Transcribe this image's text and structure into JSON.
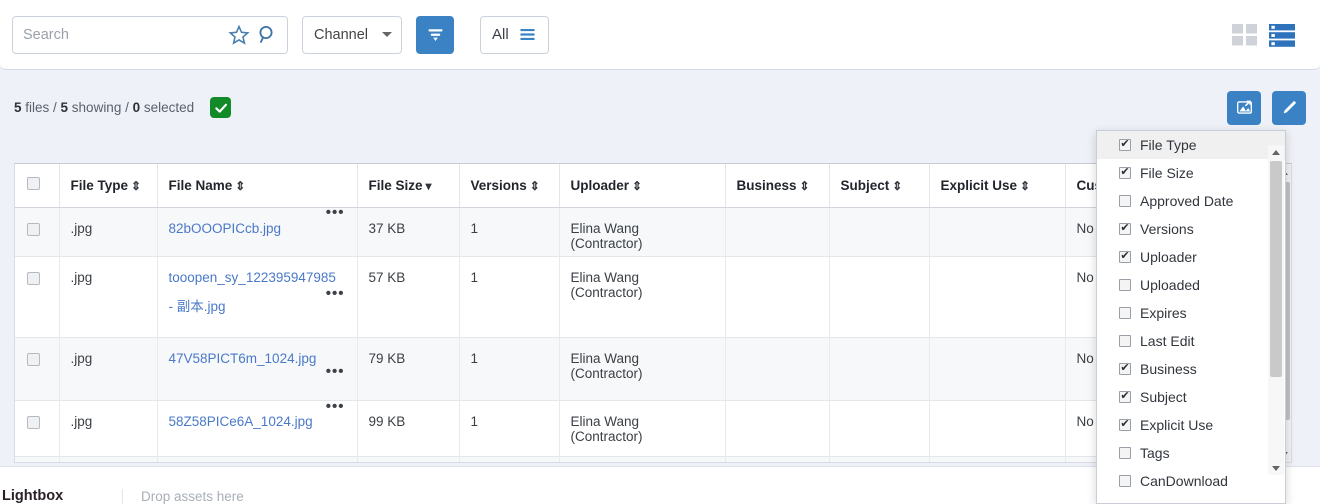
{
  "topbar": {
    "search": {
      "placeholder": "Search",
      "value": ""
    },
    "star_icon": "star-icon",
    "search_icon": "search-icon",
    "channel": {
      "label": "Channel"
    },
    "filter_button": {
      "icon": "filter-funnel-icon"
    },
    "all_button": {
      "label": "All",
      "icon": "list-lines-icon"
    },
    "view_grid": {
      "icon": "grid-view-icon",
      "active": false
    },
    "view_list": {
      "icon": "list-view-icon",
      "active": true
    },
    "accent_color": "#3a82c4"
  },
  "status": {
    "files_count": "5",
    "files_word": " files / ",
    "showing_count": "5",
    "showing_word": " showing / ",
    "selected_count": "0",
    "selected_word": " selected",
    "check_badge": "green-check-badge",
    "check_color": "#128a28",
    "upload_button": {
      "icon": "upload-image-icon"
    },
    "edit_button": {
      "icon": "pencil-edit-icon"
    }
  },
  "table": {
    "select_all_checked": false,
    "columns": [
      {
        "label": "File Type",
        "sort": "both"
      },
      {
        "label": "File Name",
        "sort": "both"
      },
      {
        "label": "File Size",
        "sort": "desc"
      },
      {
        "label": "Versions",
        "sort": "both"
      },
      {
        "label": "Uploader",
        "sort": "both"
      },
      {
        "label": "Business",
        "sort": "both"
      },
      {
        "label": "Subject",
        "sort": "both"
      },
      {
        "label": "Explicit Use",
        "sort": "both"
      },
      {
        "label": "Cust",
        "sort": "none"
      }
    ],
    "rows": [
      {
        "checked": false,
        "file_type": ".jpg",
        "file_name": "82bOOOPICcb.jpg",
        "file_name_2": "",
        "file_size": "37 KB",
        "versions": "1",
        "uploader": "Elina Wang (Contractor)",
        "business": "",
        "subject": "",
        "explicit_use": "",
        "cust": "No"
      },
      {
        "checked": false,
        "file_type": ".jpg",
        "file_name": "tooopen_sy_122395947985",
        "file_name_2": "- 副本.jpg",
        "file_size": "57 KB",
        "versions": "1",
        "uploader": "Elina Wang (Contractor)",
        "business": "",
        "subject": "",
        "explicit_use": "",
        "cust": "No"
      },
      {
        "checked": false,
        "file_type": ".jpg",
        "file_name": "47V58PICT6m_1024.jpg",
        "file_name_2": "",
        "file_size": "79 KB",
        "versions": "1",
        "uploader": "Elina Wang (Contractor)",
        "business": "",
        "subject": "",
        "explicit_use": "",
        "cust": "No"
      },
      {
        "checked": false,
        "file_type": ".jpg",
        "file_name": "58Z58PICe6A_1024.jpg",
        "file_name_2": "",
        "file_size": "99 KB",
        "versions": "1",
        "uploader": "Elina Wang (Contractor)",
        "business": "",
        "subject": "",
        "explicit_use": "",
        "cust": "No"
      }
    ],
    "row_menu_glyph": "•••"
  },
  "column_menu": {
    "items": [
      {
        "label": "File Type",
        "checked": true,
        "highlighted": true
      },
      {
        "label": "File Size",
        "checked": true,
        "highlighted": false
      },
      {
        "label": "Approved Date",
        "checked": false,
        "highlighted": false
      },
      {
        "label": "Versions",
        "checked": true,
        "highlighted": false
      },
      {
        "label": "Uploader",
        "checked": true,
        "highlighted": false
      },
      {
        "label": "Uploaded",
        "checked": false,
        "highlighted": false
      },
      {
        "label": "Expires",
        "checked": false,
        "highlighted": false
      },
      {
        "label": "Last Edit",
        "checked": false,
        "highlighted": false
      },
      {
        "label": "Business",
        "checked": true,
        "highlighted": false
      },
      {
        "label": "Subject",
        "checked": true,
        "highlighted": false
      },
      {
        "label": "Explicit Use",
        "checked": true,
        "highlighted": false
      },
      {
        "label": "Tags",
        "checked": false,
        "highlighted": false
      },
      {
        "label": "CanDownload",
        "checked": false,
        "highlighted": false
      }
    ],
    "tick_glyph": "✔"
  },
  "lightbox": {
    "label": "Lightbox",
    "drop_text": "Drop assets here"
  }
}
